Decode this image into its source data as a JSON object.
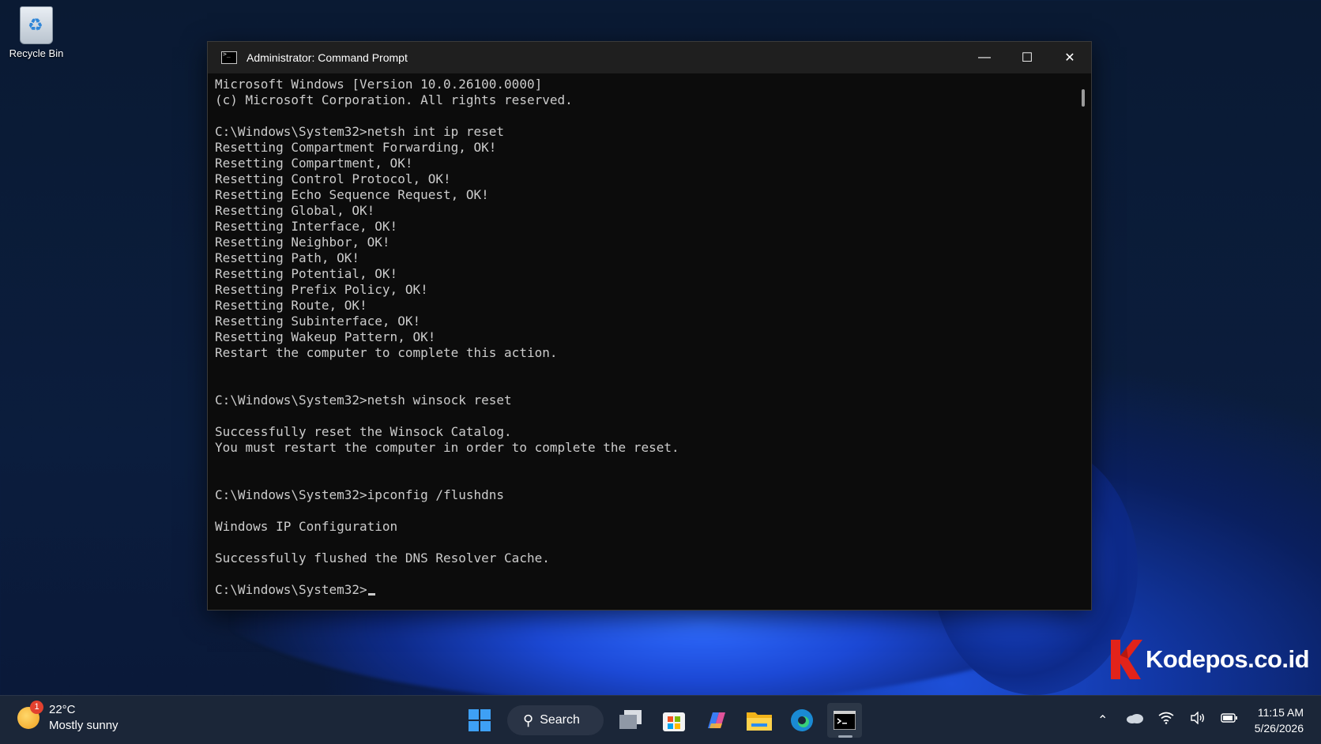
{
  "desktop": {
    "icons": [
      {
        "label": "Recycle Bin",
        "icon": "recycle-bin-icon"
      }
    ]
  },
  "window": {
    "title": "Administrator: Command Prompt",
    "controls": {
      "minimize": "—",
      "maximize": "☐",
      "close": "✕"
    }
  },
  "terminal": {
    "lines": [
      "Microsoft Windows [Version 10.0.26100.0000]",
      "(c) Microsoft Corporation. All rights reserved.",
      "",
      "C:\\Windows\\System32>netsh int ip reset",
      "Resetting Compartment Forwarding, OK!",
      "Resetting Compartment, OK!",
      "Resetting Control Protocol, OK!",
      "Resetting Echo Sequence Request, OK!",
      "Resetting Global, OK!",
      "Resetting Interface, OK!",
      "Resetting Neighbor, OK!",
      "Resetting Path, OK!",
      "Resetting Potential, OK!",
      "Resetting Prefix Policy, OK!",
      "Resetting Route, OK!",
      "Resetting Subinterface, OK!",
      "Resetting Wakeup Pattern, OK!",
      "Restart the computer to complete this action.",
      "",
      "",
      "C:\\Windows\\System32>netsh winsock reset",
      "",
      "Successfully reset the Winsock Catalog.",
      "You must restart the computer in order to complete the reset.",
      "",
      "",
      "C:\\Windows\\System32>ipconfig /flushdns",
      "",
      "Windows IP Configuration",
      "",
      "Successfully flushed the DNS Resolver Cache.",
      ""
    ],
    "prompt": "C:\\Windows\\System32>"
  },
  "watermark": {
    "text": "Kodepos.co.id"
  },
  "taskbar": {
    "weather": {
      "temp": "22°C",
      "condition": "Mostly sunny",
      "badge": "1"
    },
    "search_label": "Search",
    "apps": [
      "start-icon",
      "task-view-icon",
      "store-icon",
      "copilot-icon",
      "file-explorer-icon",
      "edge-icon",
      "terminal-icon"
    ],
    "clock": {
      "time": "11:15 AM",
      "date": "5/26/2026"
    }
  },
  "colors": {
    "accent": "#2f6bff",
    "terminal_bg": "#0c0c0c",
    "terminal_fg": "#cccccc",
    "taskbar_bg": "#1b2638"
  }
}
